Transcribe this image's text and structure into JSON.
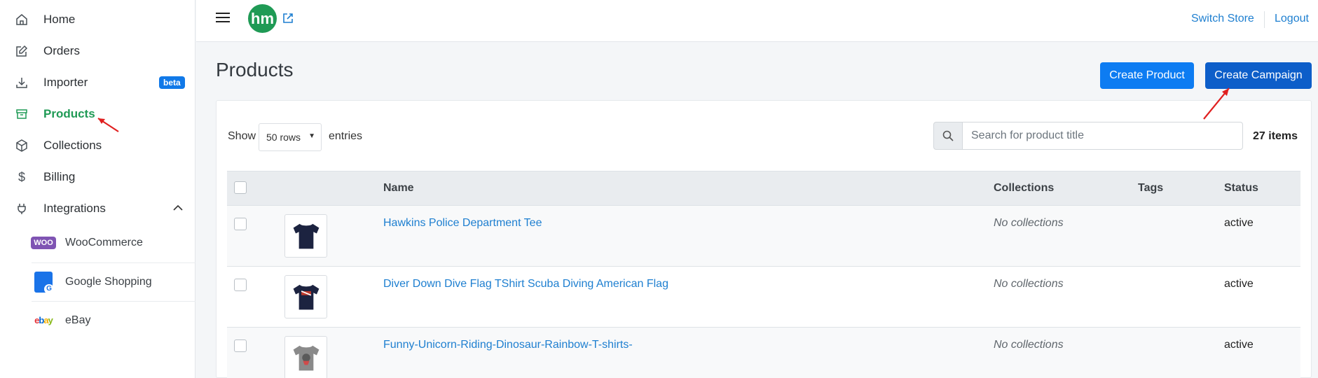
{
  "sidebar": {
    "items": [
      {
        "label": "Home",
        "icon": "home-icon"
      },
      {
        "label": "Orders",
        "icon": "edit-icon"
      },
      {
        "label": "Importer",
        "icon": "download-icon",
        "badge": "beta"
      },
      {
        "label": "Products",
        "icon": "archive-icon",
        "active": true
      },
      {
        "label": "Collections",
        "icon": "box-icon"
      },
      {
        "label": "Billing",
        "icon": "dollar-icon"
      },
      {
        "label": "Integrations",
        "icon": "plug-icon",
        "expanded": true
      }
    ],
    "integrations": [
      {
        "label": "WooCommerce",
        "icon": "woocommerce-icon",
        "logo_text": "WOO"
      },
      {
        "label": "Google Shopping",
        "icon": "google-shopping-icon",
        "logo_text": "G"
      },
      {
        "label": "eBay",
        "icon": "ebay-icon",
        "logo_text": "ebay"
      }
    ]
  },
  "topbar": {
    "logo_text": "hm",
    "switch_store": "Switch Store",
    "logout": "Logout"
  },
  "page": {
    "title": "Products",
    "create_product": "Create Product",
    "create_campaign": "Create Campaign"
  },
  "controls": {
    "show_label": "Show",
    "rows_value": "50 rows",
    "entries_label": "entries",
    "search_placeholder": "Search for product title",
    "items_count": "27 items"
  },
  "table": {
    "columns": [
      "Name",
      "Collections",
      "Tags",
      "Status"
    ],
    "rows": [
      {
        "name": "Hawkins Police Department Tee",
        "collections": "No collections",
        "tags": "",
        "status": "active",
        "shirt_color": "#1c2340"
      },
      {
        "name": "Diver Down Dive Flag TShirt Scuba Diving American Flag",
        "collections": "No collections",
        "tags": "",
        "status": "active",
        "shirt_color": "#1c2340"
      },
      {
        "name": "Funny-Unicorn-Riding-Dinosaur-Rainbow-T-shirts-",
        "collections": "No collections",
        "tags": "",
        "status": "active",
        "shirt_color": "#8a8a8a"
      }
    ]
  },
  "colors": {
    "brand_green": "#1f9a55",
    "primary_blue": "#0d7cf2",
    "dark_blue": "#0d5ec9",
    "link_blue": "#1e7fd0",
    "annotation_red": "#e02020"
  }
}
